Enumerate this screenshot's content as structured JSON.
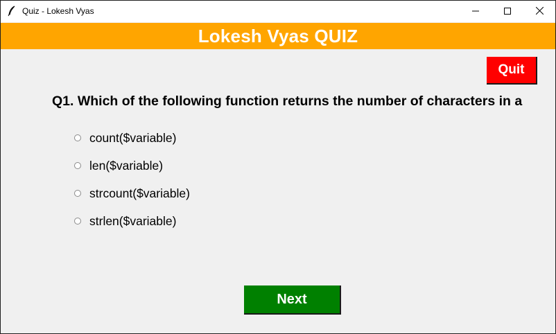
{
  "window": {
    "title": "Quiz - Lokesh Vyas",
    "app_icon": "feather-icon",
    "controls": {
      "minimize_icon": "minimize-icon",
      "maximize_icon": "maximize-icon",
      "close_icon": "close-icon"
    }
  },
  "header": {
    "title": "Lokesh Vyas QUIZ",
    "background_color": "#ffa500",
    "text_color": "#ffffff"
  },
  "quit_button": {
    "label": "Quit",
    "background_color": "#ff0000"
  },
  "question": {
    "text": "Q1. Which of the following function returns the number of characters in a"
  },
  "options": [
    {
      "label": "count($variable)",
      "selected": false
    },
    {
      "label": "len($variable)",
      "selected": false
    },
    {
      "label": "strcount($variable)",
      "selected": false
    },
    {
      "label": "strlen($variable)",
      "selected": false
    }
  ],
  "next_button": {
    "label": "Next",
    "background_color": "#008000"
  }
}
